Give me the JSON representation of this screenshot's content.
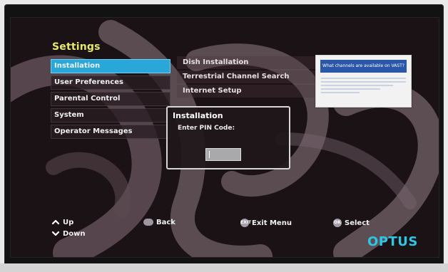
{
  "settings": {
    "title": "Settings"
  },
  "menu": {
    "items": [
      {
        "label": "Installation",
        "selected": true
      },
      {
        "label": "User Preferences",
        "selected": false
      },
      {
        "label": "Parental Control",
        "selected": false
      },
      {
        "label": "System",
        "selected": false
      },
      {
        "label": "Operator Messages",
        "selected": false
      }
    ]
  },
  "submenu": {
    "items": [
      {
        "label": "Dish Installation"
      },
      {
        "label": "Terrestrial Channel Search"
      },
      {
        "label": "Internet Setup"
      }
    ]
  },
  "info_card": {
    "heading": "What channels are available on VAST?"
  },
  "dialog": {
    "title": "Installation",
    "prompt": "Enter PIN Code:"
  },
  "hints": {
    "up": "Up",
    "down": "Down",
    "back": "Back",
    "exit_menu": "Exit Menu",
    "select": "Select",
    "exit_badge": "EXIT",
    "ok_badge": "OK"
  },
  "brand": {
    "name": "OPTUS"
  },
  "colors": {
    "accent": "#2aa7d9",
    "title": "#e7e96a",
    "brand": "#2cc7e5"
  }
}
